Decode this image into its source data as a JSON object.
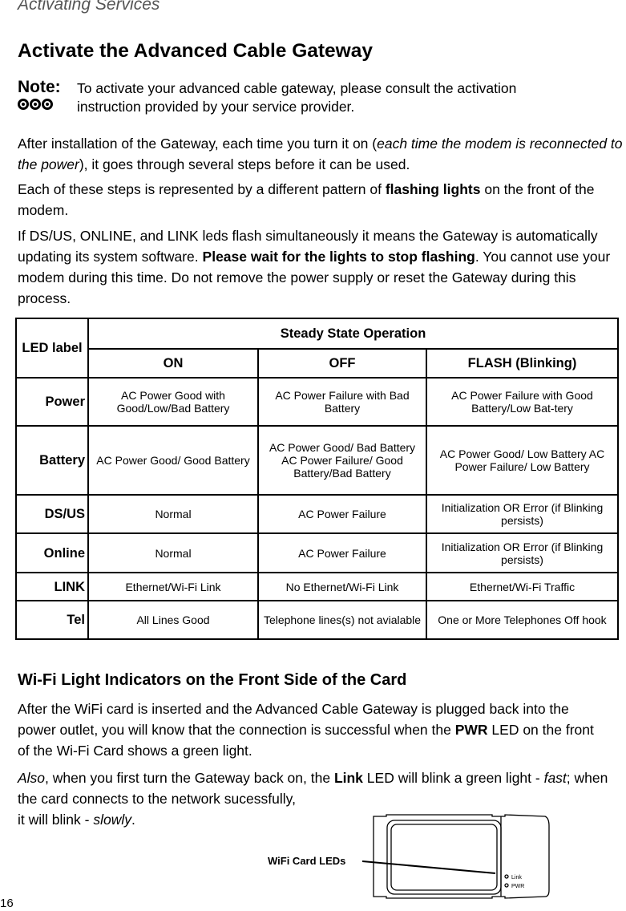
{
  "running_head": "Activating Services",
  "title": "Activate the Advanced Cable Gateway",
  "note": {
    "label": "Note:",
    "icon": "three-dots-icon",
    "text": "To activate your advanced cable gateway, please consult the activation instruction provided by your service provider."
  },
  "paragraphs": {
    "p1_a": "After installation of the Gateway, each time you turn it on (",
    "p1_italic": "each time the modem is reconnected to the power",
    "p1_b": "), it goes through several steps before it can be used.",
    "p2_a": "Each of these steps is represented by a different pattern of ",
    "p2_bold": "flashing lights",
    "p2_b": " on the front of the modem.",
    "p3_a": "If DS/US, ONLINE, and LINK leds flash simultaneously it means the Gateway is automatically updating its system software. ",
    "p3_bold": "Please wait for the lights to stop flashing",
    "p3_b": ". You cannot use your modem during this time. Do not remove the power supply or reset the Gateway during this process."
  },
  "table": {
    "corner": "LED label",
    "group_header": "Steady State Operation",
    "columns": [
      "ON",
      "OFF",
      "FLASH (Blinking)"
    ],
    "rows": [
      {
        "label": "Power",
        "on": "AC Power Good with Good/Low/Bad Battery",
        "off": "AC Power Failure with Bad Battery",
        "flash": "AC Power Failure with Good Battery/Low Bat-tery"
      },
      {
        "label": "Battery",
        "on": "AC Power Good/ Good Battery",
        "off": "AC Power Good/ Bad Battery AC Power Failure/ Good Battery/Bad Battery",
        "flash": "AC Power Good/ Low Battery AC Power Failure/ Low Battery"
      },
      {
        "label": "DS/US",
        "on": "Normal",
        "off": "AC Power Failure",
        "flash": "Initialization OR Error (if Blinking persists)"
      },
      {
        "label": "Online",
        "on": "Normal",
        "off": "AC Power Failure",
        "flash": "Initialization OR Error (if Blinking persists)"
      },
      {
        "label": "LINK",
        "on": "Ethernet/Wi-Fi Link",
        "off": "No Ethernet/Wi-Fi Link",
        "flash": "Ethernet/Wi-Fi Traffic"
      },
      {
        "label": "Tel",
        "on": "All Lines Good",
        "off": "Telephone lines(s) not avialable",
        "flash": "One or More Telephones Off hook"
      }
    ]
  },
  "wifi_section": {
    "heading": "Wi-Fi Light Indicators on the Front Side of the Card",
    "p1_a": "After the WiFi card is inserted and the Advanced Cable Gateway is plugged back into the power outlet, you will know that the connection is successful when the ",
    "p1_bold": "PWR",
    "p1_b": " LED on the front of the Wi-Fi Card shows a green light.",
    "p2_italic1": "Also",
    "p2_a": ", when you first turn the Gateway back on, the ",
    "p2_bold": "Link",
    "p2_b": " LED will blink a green light - ",
    "p2_italic2": "fast",
    "p2_c": "; when the card connects to the network sucessfully,",
    "p2_d": "it will blink - ",
    "p2_italic3": "slowly",
    "p2_e": "."
  },
  "figure": {
    "callout": "WiFi Card LEDs",
    "led_link": "Link",
    "led_pwr": "PWR"
  },
  "page_number": "16"
}
